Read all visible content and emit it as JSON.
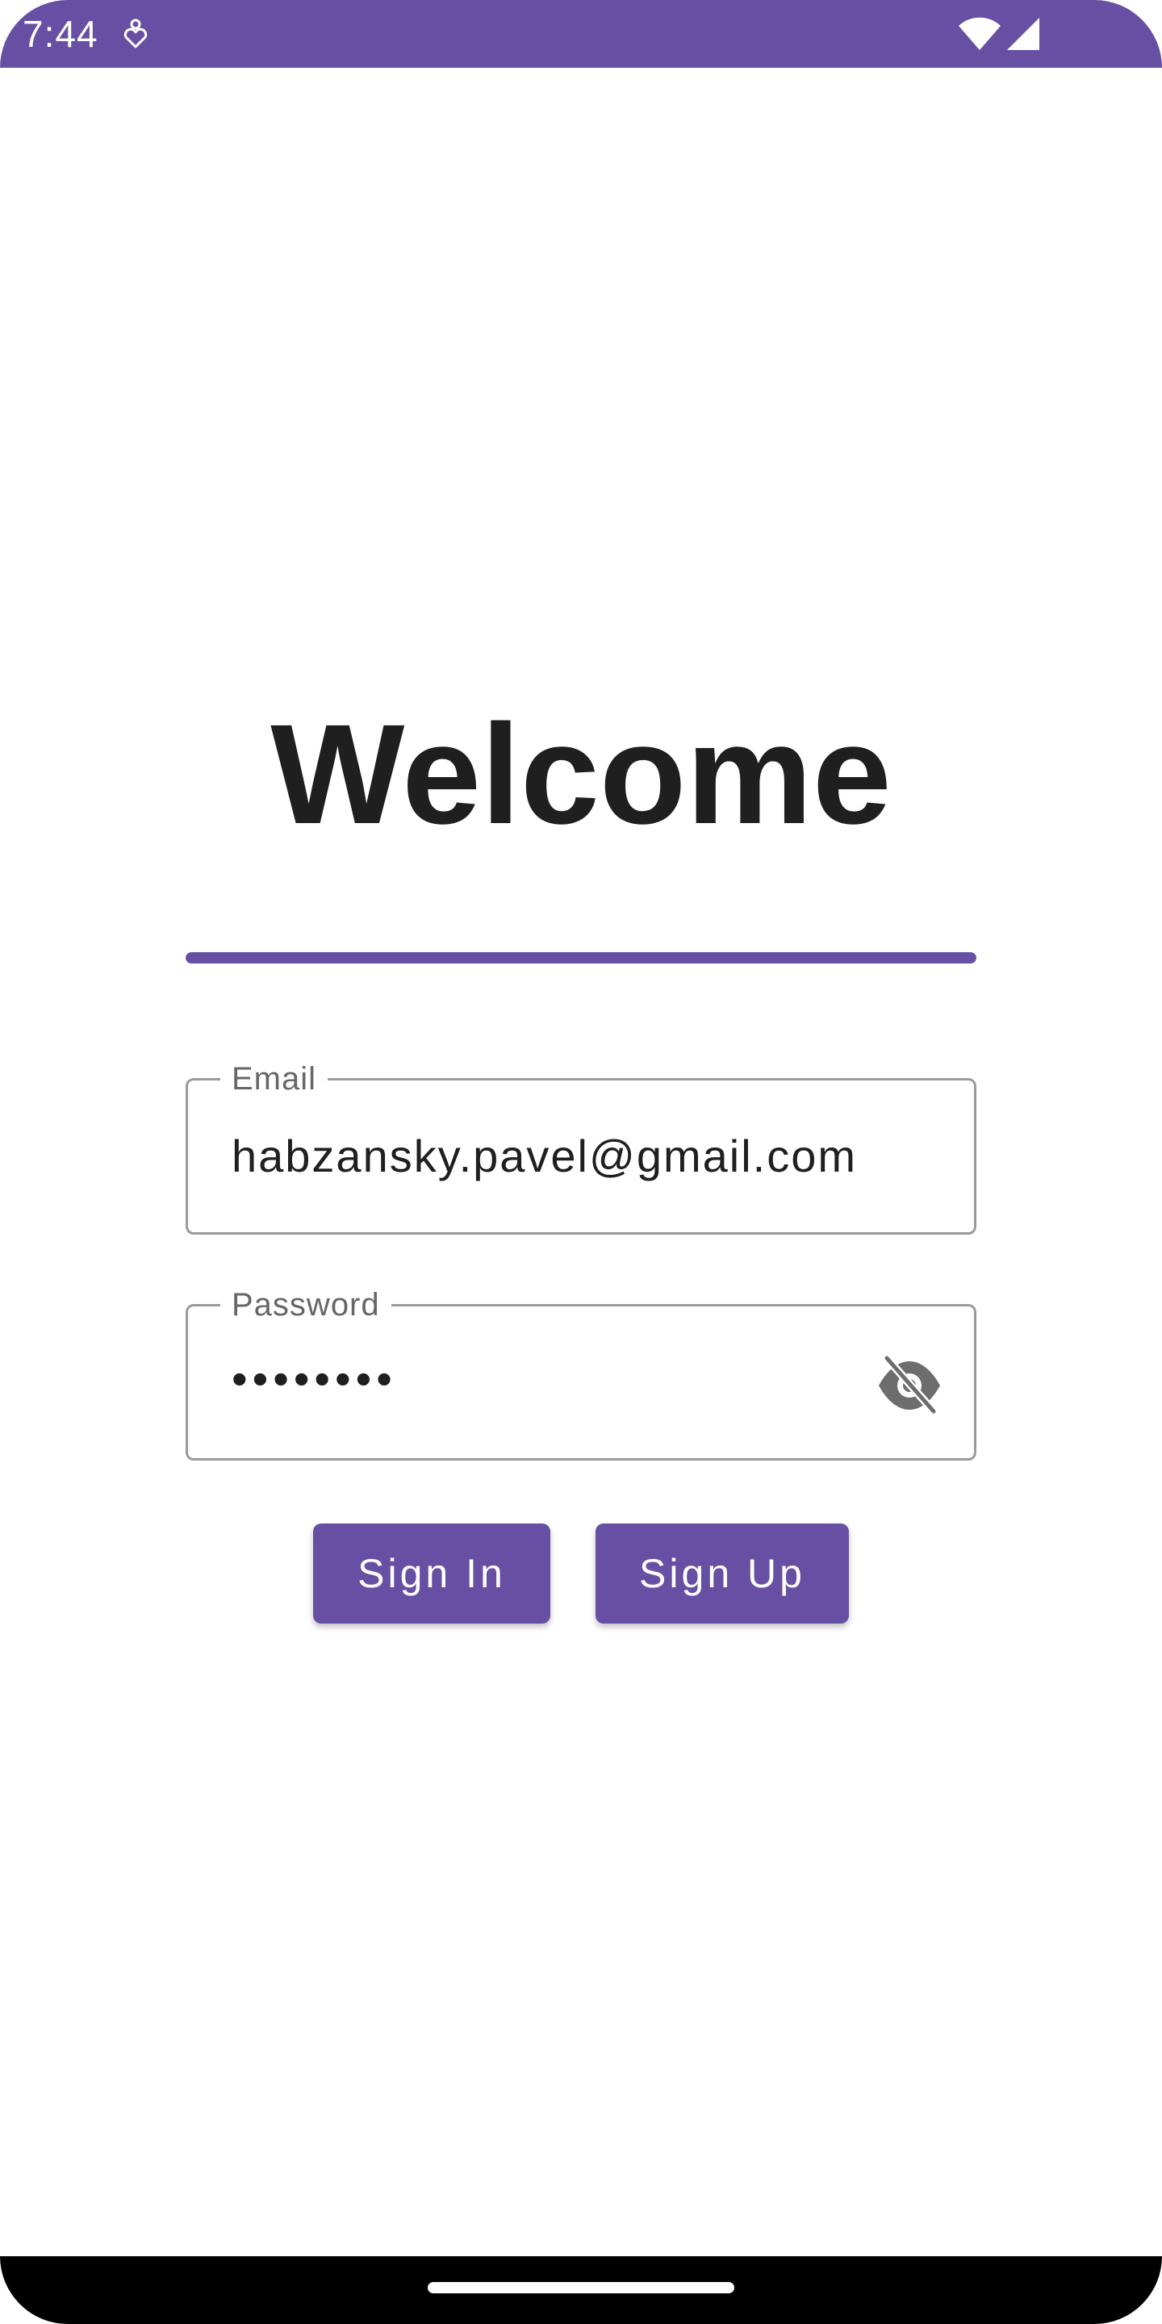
{
  "status_bar": {
    "time": "7:44",
    "icons": [
      "notification-icon",
      "wifi-icon",
      "cellular-signal-icon"
    ]
  },
  "title": "Welcome",
  "progress": {
    "fraction": 1.0
  },
  "email_field": {
    "label": "Email",
    "value": "habzansky.pavel@gmail.com"
  },
  "password_field": {
    "label": "Password",
    "value": "••••••••",
    "toggle_icon": "visibility-off-icon"
  },
  "buttons": {
    "sign_in": "Sign In",
    "sign_up": "Sign Up"
  },
  "colors": {
    "primary": "#6750a4",
    "outline": "#9a9a9a",
    "text": "#1f1f1f"
  }
}
